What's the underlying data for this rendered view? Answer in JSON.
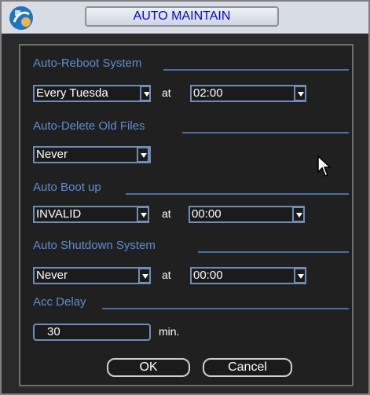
{
  "window": {
    "title": "AUTO MAINTAIN"
  },
  "sections": {
    "auto_reboot": {
      "label": "Auto-Reboot System",
      "day_value": "Every Tuesda",
      "at_label": "at",
      "time_value": "02:00"
    },
    "auto_delete": {
      "label": "Auto-Delete Old Files",
      "value": "Never"
    },
    "auto_boot": {
      "label": "Auto Boot up",
      "value": "INVALID",
      "at_label": "at",
      "time_value": "00:00"
    },
    "auto_shutdown": {
      "label": "Auto Shutdown System",
      "value": "Never",
      "at_label": "at",
      "time_value": "00:00"
    },
    "acc_delay": {
      "label": "Acc Delay",
      "value": "30",
      "unit": "min."
    }
  },
  "buttons": {
    "ok": "OK",
    "cancel": "Cancel"
  },
  "colors": {
    "label_blue": "#5f8ed6",
    "title_text": "#0000ee",
    "field_border": "#6f8db8",
    "panel_bg": "#202020"
  },
  "icons": {
    "logo": "app-logo-icon",
    "cursor": "mouse-cursor-icon"
  }
}
